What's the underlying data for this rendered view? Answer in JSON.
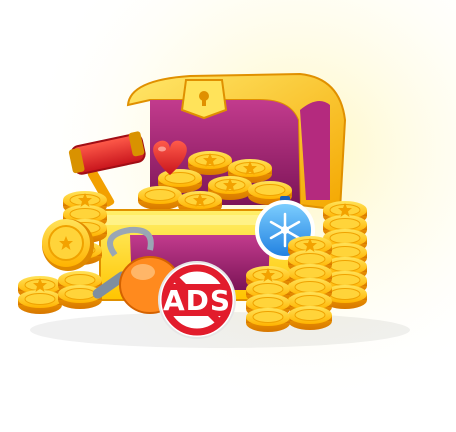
{
  "scene": {
    "background": "#ffffff",
    "glow_color": "#fff3b0",
    "chest": {
      "body_color": "#ffd400",
      "interior_color": "#9b1d6a",
      "lid_trim_color": "#f7b500"
    },
    "coin_color": "#ffc21a",
    "coin_dark": "#e08a00",
    "items": [
      {
        "name": "hammer",
        "icon": "hammer-icon"
      },
      {
        "name": "heart",
        "icon": "heart-icon"
      },
      {
        "name": "vacuum",
        "icon": "vacuum-icon"
      },
      {
        "name": "freeze-timer",
        "icon": "snowflake-stopwatch-icon"
      },
      {
        "name": "no-ads",
        "icon": "no-ads-icon"
      }
    ],
    "no_ads_label": "ADS"
  }
}
